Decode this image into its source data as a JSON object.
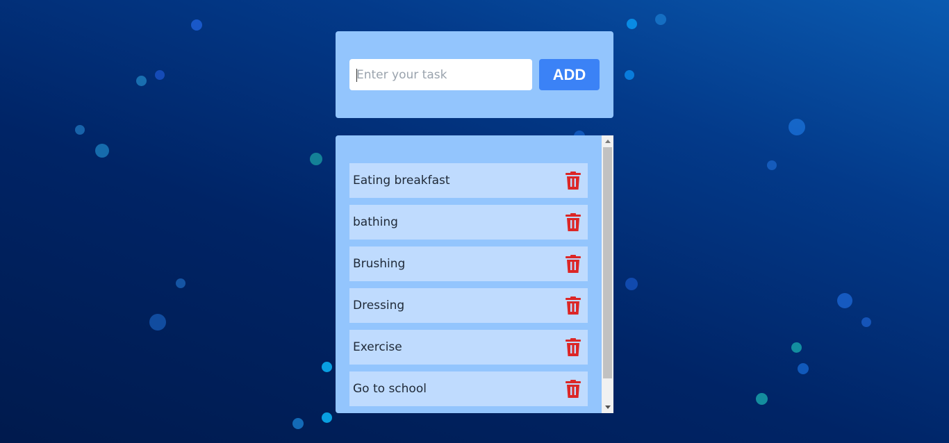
{
  "input": {
    "placeholder": "Enter your task",
    "value": ""
  },
  "add_button": {
    "label": "ADD"
  },
  "tasks": [
    {
      "label": "Eating breakfast",
      "delete_icon": "trash-icon"
    },
    {
      "label": "bathing",
      "delete_icon": "trash-icon"
    },
    {
      "label": "Brushing",
      "delete_icon": "trash-icon"
    },
    {
      "label": "Dressing",
      "delete_icon": "trash-icon"
    },
    {
      "label": "Exercise",
      "delete_icon": "trash-icon"
    },
    {
      "label": "Go to school",
      "delete_icon": "trash-icon"
    }
  ],
  "colors": {
    "background_dark": "#001a4d",
    "background_light": "#0a5ab0",
    "card": "#93c5fd",
    "task_item": "#bfdbfe",
    "accent_button": "#3b82f6",
    "delete_icon": "#dc2626"
  }
}
